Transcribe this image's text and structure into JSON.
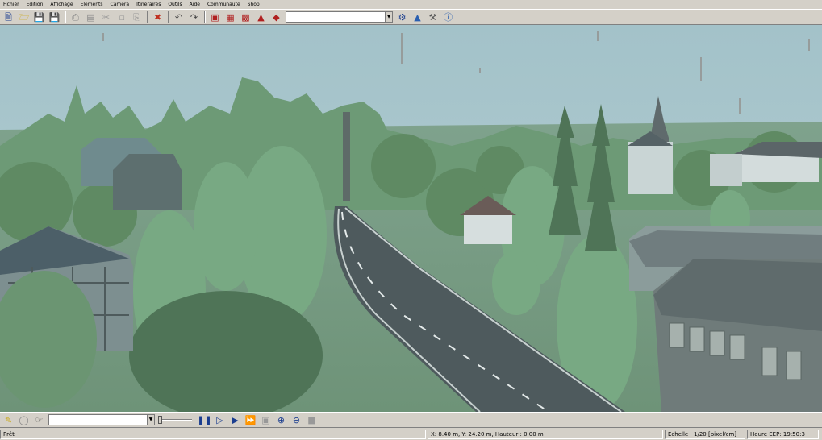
{
  "menu": [
    "Fichier",
    "Edition",
    "Affichage",
    "Eléments",
    "Caméra",
    "Itinéraires",
    "Outils",
    "Aide",
    "Communauté",
    "Shop"
  ],
  "toolbar": {
    "icons": [
      "new-file-icon",
      "open-folder-icon",
      "save-icon",
      "save-as-icon",
      "print-icon",
      "page-setup-icon",
      "cut-icon",
      "copy-icon",
      "paste-icon",
      "delete-icon",
      "undo-icon",
      "redo-icon",
      "train-editor-icon",
      "rail-editor-icon",
      "road-editor-icon",
      "signal-editor-icon",
      "layout-icon"
    ],
    "combo_value": "",
    "right_icons": [
      "settings-icon",
      "terrain-icon",
      "tools-icon",
      "info-icon"
    ]
  },
  "bottombar": {
    "icons": [
      "edit-icon",
      "lightbulb-icon",
      "cursor-icon"
    ],
    "combo_value": "",
    "slider_value": 0,
    "media_icons": [
      "pause-icon",
      "play-icon",
      "fast-forward-icon",
      "faster-forward-icon",
      "record-icon",
      "zoom-in-icon",
      "zoom-out-icon",
      "lock-icon"
    ]
  },
  "status": {
    "ready": "Prêt",
    "coords": "X: 8.40 m, Y: 24.20 m, Hauteur : 0.00 m",
    "scale": "Echelle : 1/20 [pixel/cm]",
    "time": "Heure EEP: 19:50:3"
  }
}
